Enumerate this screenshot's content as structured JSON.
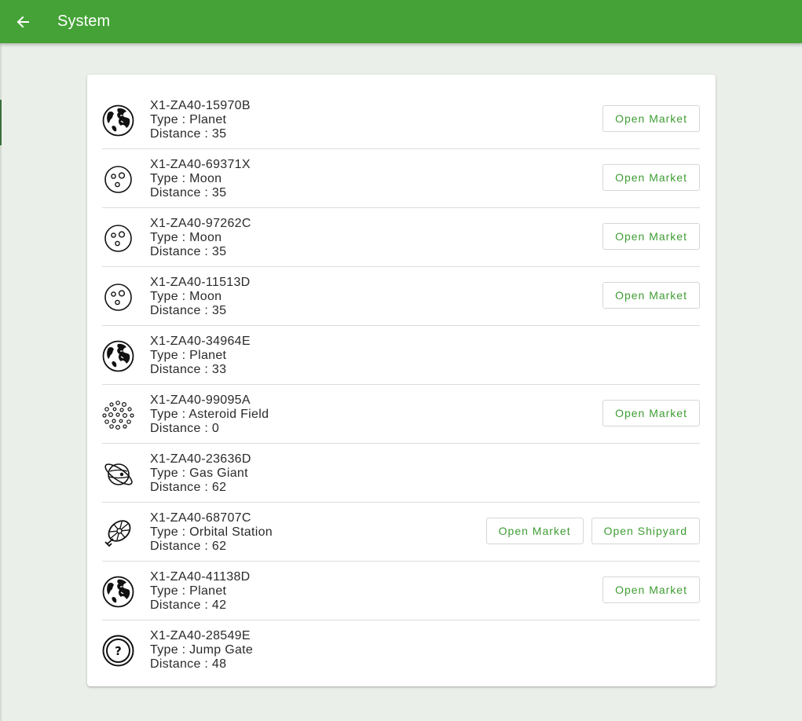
{
  "header": {
    "title": "System",
    "back_icon": "arrow-left-icon"
  },
  "colors": {
    "app_bar": "#44a236",
    "accent_text": "#3f9d34",
    "background": "#ebefe9"
  },
  "labels": {
    "type_prefix": "Type : ",
    "distance_prefix": "Distance : "
  },
  "waypoints": [
    {
      "symbol": "X1-ZA40-15970B",
      "type": "Planet",
      "distance": "35",
      "icon": "planet-icon",
      "buttons": [
        "Open Market"
      ]
    },
    {
      "symbol": "X1-ZA40-69371X",
      "type": "Moon",
      "distance": "35",
      "icon": "moon-icon",
      "buttons": [
        "Open Market"
      ]
    },
    {
      "symbol": "X1-ZA40-97262C",
      "type": "Moon",
      "distance": "35",
      "icon": "moon-icon",
      "buttons": [
        "Open Market"
      ]
    },
    {
      "symbol": "X1-ZA40-11513D",
      "type": "Moon",
      "distance": "35",
      "icon": "moon-icon",
      "buttons": [
        "Open Market"
      ]
    },
    {
      "symbol": "X1-ZA40-34964E",
      "type": "Planet",
      "distance": "33",
      "icon": "planet-icon",
      "buttons": []
    },
    {
      "symbol": "X1-ZA40-99095A",
      "type": "Asteroid Field",
      "distance": "0",
      "icon": "asteroid-field-icon",
      "buttons": [
        "Open Market"
      ]
    },
    {
      "symbol": "X1-ZA40-23636D",
      "type": "Gas Giant",
      "distance": "62",
      "icon": "gas-giant-icon",
      "buttons": []
    },
    {
      "symbol": "X1-ZA40-68707C",
      "type": "Orbital Station",
      "distance": "62",
      "icon": "orbital-station-icon",
      "buttons": [
        "Open Market",
        "Open Shipyard"
      ]
    },
    {
      "symbol": "X1-ZA40-41138D",
      "type": "Planet",
      "distance": "42",
      "icon": "planet-icon",
      "buttons": [
        "Open Market"
      ]
    },
    {
      "symbol": "X1-ZA40-28549E",
      "type": "Jump Gate",
      "distance": "48",
      "icon": "jump-gate-icon",
      "buttons": []
    }
  ]
}
